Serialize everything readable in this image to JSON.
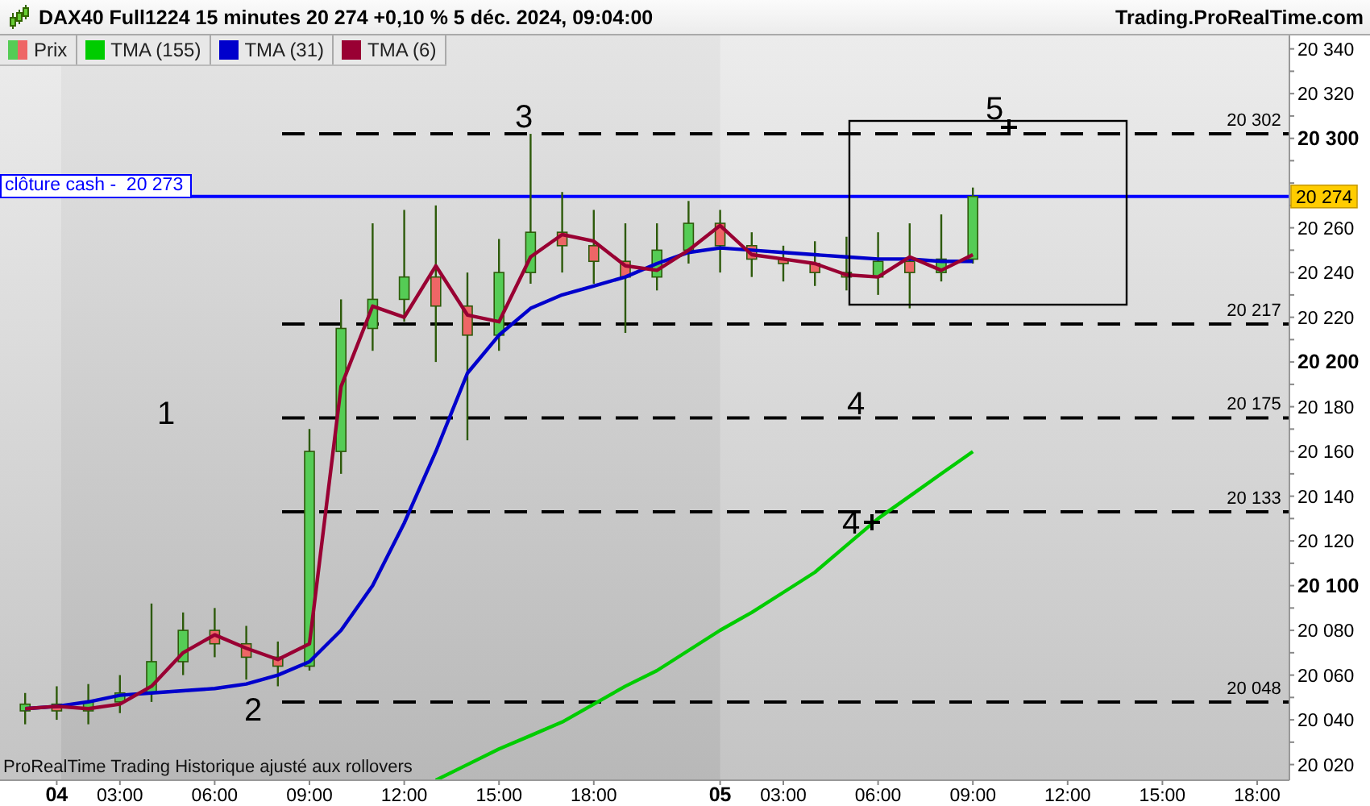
{
  "header": {
    "title": "DAX40 Full1224 15 minutes 20 274 +0,10 % 5 déc. 2024, 09:04:00",
    "site": "Trading.ProRealTime.com"
  },
  "price_label": "Prix",
  "note": "ProRealTime Trading  Historique ajusté aux rollovers",
  "last_price": "20 274",
  "wave_labels": [
    "1",
    "2",
    "3",
    "4",
    "4",
    "5"
  ],
  "chart_data": {
    "type": "candlestick",
    "legend": "upper left",
    "categories": [
      null,
      "04",
      null,
      "03:00",
      null,
      null,
      "06:00",
      null,
      null,
      "09:00",
      null,
      null,
      "12:00",
      null,
      null,
      "15:00",
      null,
      null,
      "18:00",
      null,
      null,
      null,
      "05",
      null,
      "03:00",
      null,
      null,
      "06:00",
      null,
      null,
      "09:00",
      null,
      null,
      "12:00",
      null,
      null,
      "15:00",
      null,
      null,
      "18:00"
    ],
    "ohlc": [
      [
        20044,
        20052,
        20038,
        20047
      ],
      [
        20047,
        20055,
        20040,
        20044
      ],
      [
        20044,
        20056,
        20038,
        20048
      ],
      [
        20048,
        20060,
        20043,
        20052
      ],
      [
        20052,
        20092,
        20048,
        20066
      ],
      [
        20066,
        20088,
        20060,
        20080
      ],
      [
        20080,
        20090,
        20068,
        20074
      ],
      [
        20074,
        20082,
        20058,
        20068
      ],
      [
        20068,
        20075,
        20055,
        20064
      ],
      [
        20064,
        20170,
        20062,
        20160
      ],
      [
        20160,
        20228,
        20150,
        20215
      ],
      [
        20215,
        20262,
        20205,
        20228
      ],
      [
        20228,
        20268,
        20218,
        20238
      ],
      [
        20238,
        20270,
        20200,
        20225
      ],
      [
        20225,
        20240,
        20165,
        20212
      ],
      [
        20212,
        20255,
        20205,
        20240
      ],
      [
        20240,
        20302,
        20235,
        20258
      ],
      [
        20258,
        20276,
        20240,
        20252
      ],
      [
        20252,
        20268,
        20235,
        20245
      ],
      [
        20245,
        20262,
        20213,
        20238
      ],
      [
        20238,
        20262,
        20232,
        20250
      ],
      [
        20250,
        20272,
        20244,
        20262
      ],
      [
        20262,
        20268,
        20240,
        20252
      ],
      [
        20252,
        20258,
        20238,
        20246
      ],
      [
        20246,
        20252,
        20236,
        20244
      ],
      [
        20244,
        20254,
        20234,
        20240
      ],
      [
        20240,
        20256,
        20232,
        20238
      ],
      [
        20238,
        20258,
        20230,
        20245
      ],
      [
        20245,
        20262,
        20224,
        20240
      ],
      [
        20240,
        20266,
        20236,
        20246
      ],
      [
        20246,
        20278,
        20244,
        20274
      ],
      null,
      null,
      null,
      null,
      null,
      null,
      null,
      null,
      null
    ],
    "ylim": [
      20013,
      20346
    ],
    "yticks": [
      {
        "value": 20340,
        "label": "20 340"
      },
      {
        "value": 20320,
        "label": "20 320"
      },
      {
        "value": 20300,
        "label": "20 300"
      },
      {
        "value": 20260,
        "label": "20 260"
      },
      {
        "value": 20240,
        "label": "20 240"
      },
      {
        "value": 20220,
        "label": "20 220"
      },
      {
        "value": 20200,
        "label": "20 200"
      },
      {
        "value": 20180,
        "label": "20 180"
      },
      {
        "value": 20160,
        "label": "20 160"
      },
      {
        "value": 20140,
        "label": "20 140"
      },
      {
        "value": 20120,
        "label": "20 120"
      },
      {
        "value": 20100,
        "label": "20 100"
      },
      {
        "value": 20080,
        "label": "20 080"
      },
      {
        "value": 20060,
        "label": "20 060"
      },
      {
        "value": 20040,
        "label": "20 040"
      },
      {
        "value": 20020,
        "label": "20 020"
      }
    ],
    "series": [
      {
        "name": "TMA (155)",
        "type": "line",
        "color": "#00cc00",
        "values": [
          null,
          null,
          null,
          null,
          null,
          null,
          null,
          null,
          null,
          null,
          null,
          null,
          null,
          20013,
          20020,
          20027,
          20033,
          20039,
          20047,
          20055,
          20062,
          20071,
          20080,
          20088,
          20097,
          20106,
          20118,
          20130,
          20140,
          20150,
          20160,
          null,
          null,
          null,
          null,
          null,
          null,
          null,
          null,
          null
        ]
      },
      {
        "name": "TMA (31)",
        "type": "line",
        "color": "#0000cc",
        "values": [
          20045,
          20046,
          20048,
          20051,
          20052,
          20053,
          20054,
          20056,
          20060,
          20066,
          20080,
          20100,
          20128,
          20160,
          20195,
          20212,
          20224,
          20230,
          20234,
          20238,
          20244,
          20249,
          20251,
          20250,
          20249,
          20248,
          20247,
          20246,
          20246,
          20245,
          20245,
          null,
          null,
          null,
          null,
          null,
          null,
          null,
          null,
          null
        ]
      },
      {
        "name": "TMA (6)",
        "type": "line",
        "color": "#990033",
        "values": [
          20045,
          20046,
          20045,
          20047,
          20055,
          20070,
          20078,
          20072,
          20067,
          20074,
          20189,
          20225,
          20220,
          20243,
          20221,
          20218,
          20247,
          20257,
          20254,
          20243,
          20241,
          20250,
          20261,
          20248,
          20246,
          20244,
          20239,
          20238,
          20247,
          20241,
          20248,
          null,
          null,
          null,
          null,
          null,
          null,
          null,
          null,
          null
        ]
      }
    ],
    "ref_lines": [
      {
        "axis": "y",
        "value": 20302,
        "label": "20 302",
        "color": "#000000"
      },
      {
        "axis": "y",
        "value": 20217,
        "label": "20 217",
        "color": "#000000"
      },
      {
        "axis": "y",
        "value": 20175,
        "label": "20 175",
        "color": "#000000"
      },
      {
        "axis": "y",
        "value": 20133,
        "label": "20 133",
        "color": "#000000"
      },
      {
        "axis": "y",
        "value": 20048,
        "label": "20 048",
        "color": "#000000"
      },
      {
        "axis": "y",
        "value": 20274,
        "label": "clôture cash -  20 273",
        "color": "#0000ff"
      }
    ]
  }
}
